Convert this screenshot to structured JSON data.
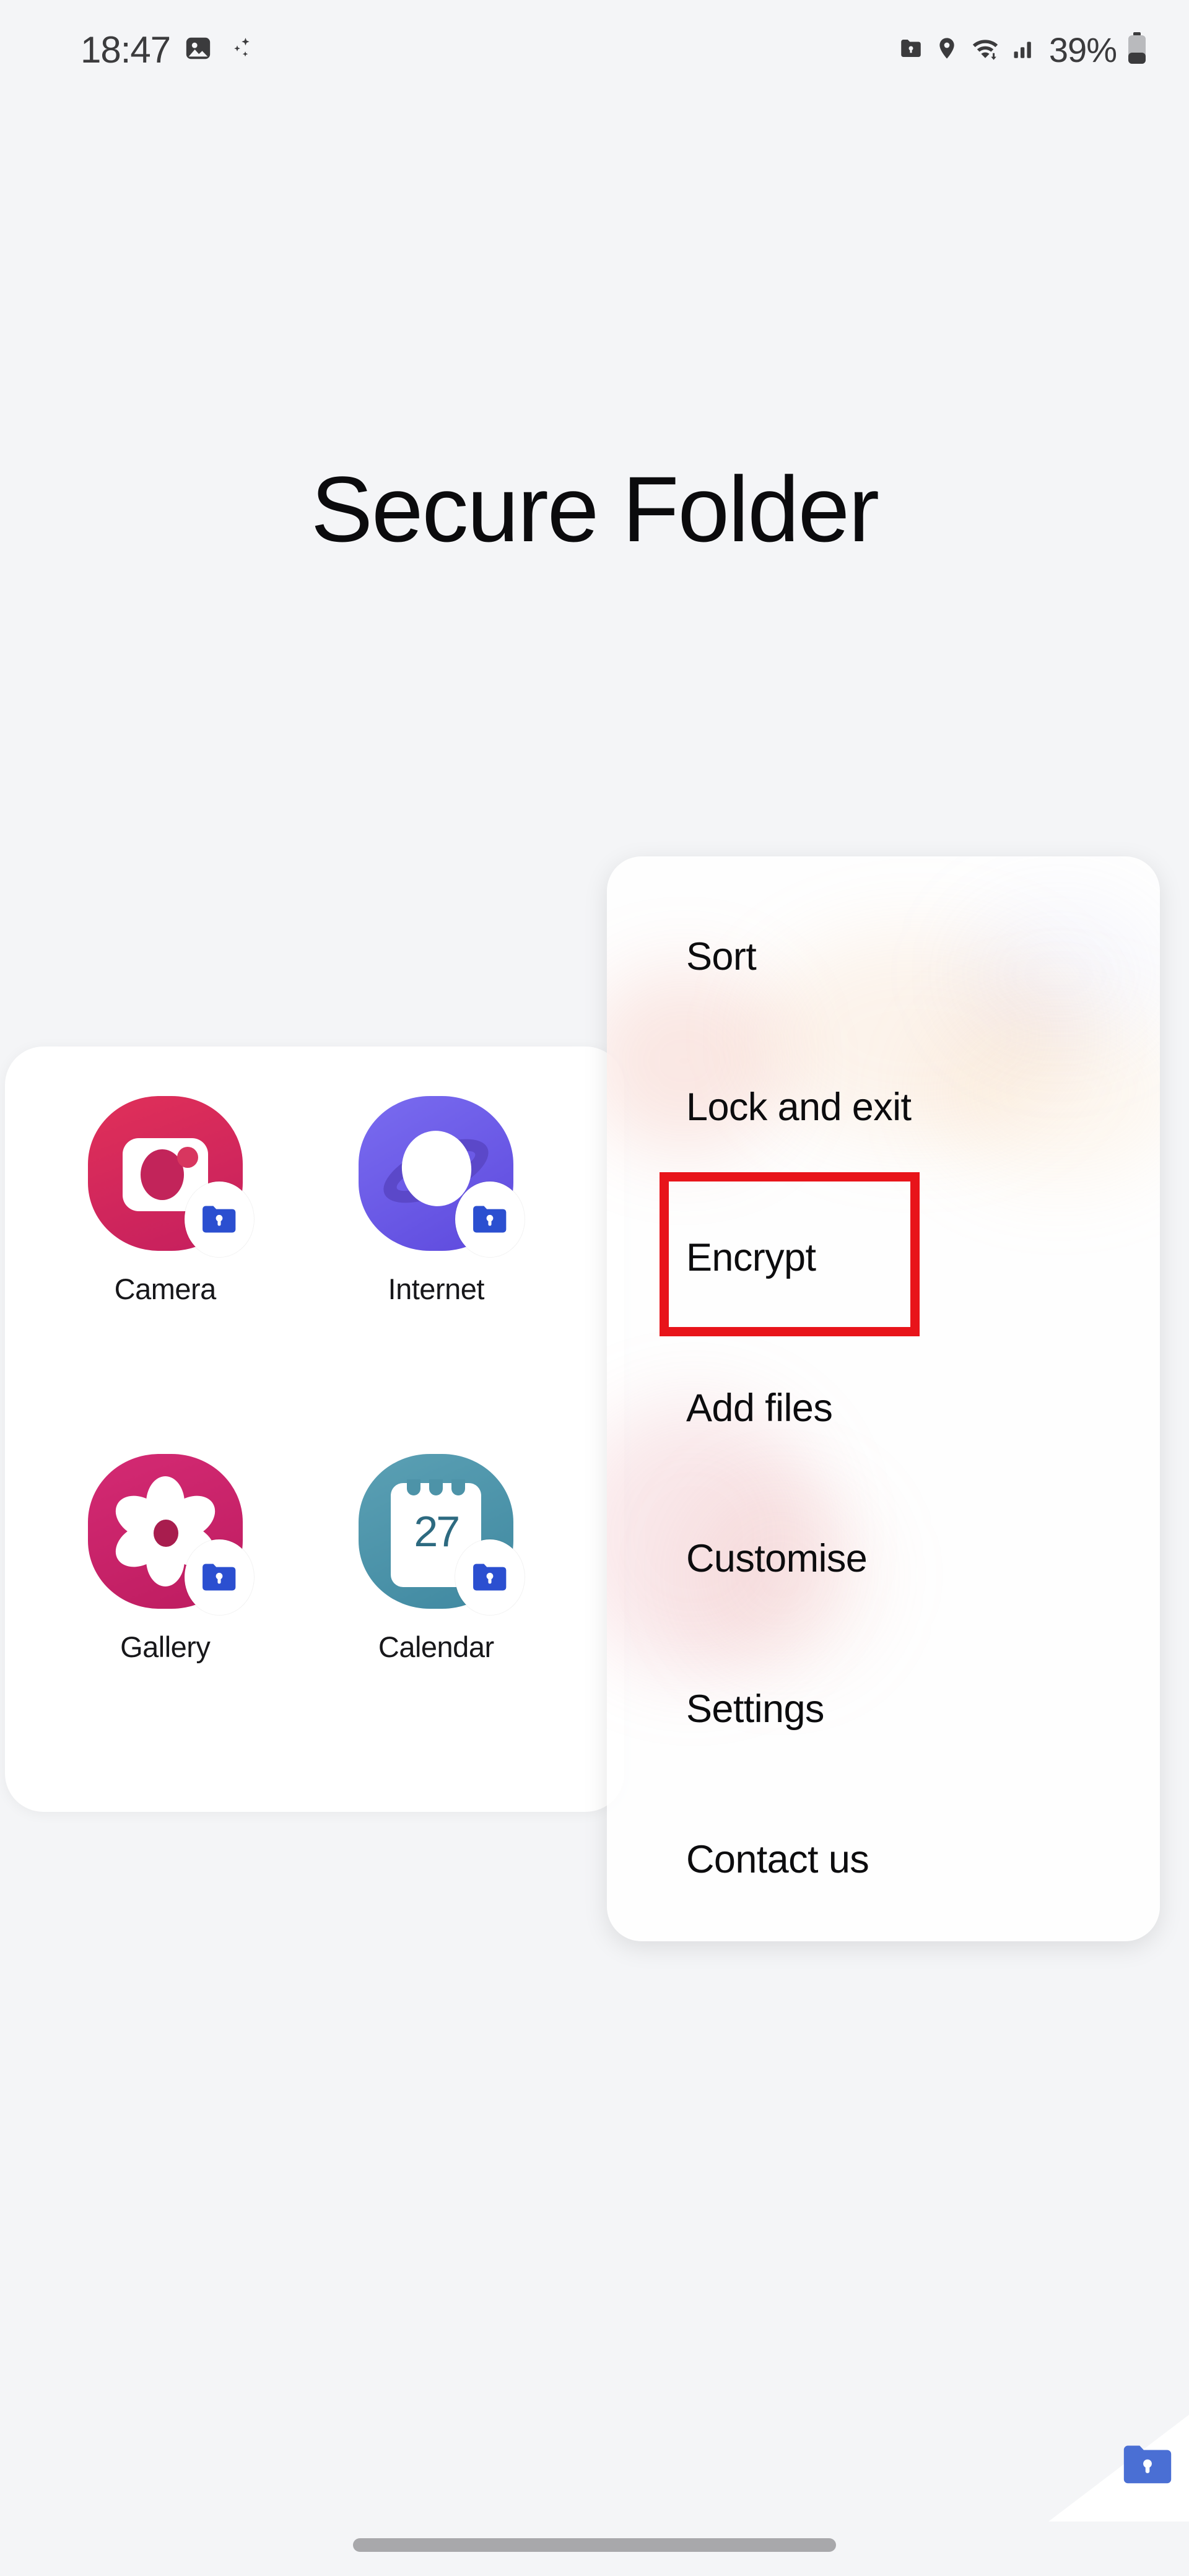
{
  "status_bar": {
    "time": "18:47",
    "battery_percent": "39%",
    "left_icons": [
      "image-icon",
      "sparkle-icon"
    ],
    "right_icons": [
      "secure-folder-icon",
      "location-pin-icon",
      "wifi-icon",
      "signal-bars-icon",
      "battery-icon"
    ]
  },
  "header": {
    "title": "Secure Folder"
  },
  "apps": [
    {
      "label": "Camera",
      "icon": "camera-icon",
      "color": "#d5295c",
      "badge": "secure-folder-lock-badge"
    },
    {
      "label": "Internet",
      "icon": "internet-icon",
      "color": "#6f5be8",
      "badge": "secure-folder-lock-badge"
    },
    {
      "label": "Gallery",
      "icon": "gallery-icon",
      "color": "#cc246c",
      "badge": "secure-folder-lock-badge"
    },
    {
      "label": "Calendar",
      "icon": "calendar-icon",
      "color": "#4d93a8",
      "badge": "secure-folder-lock-badge",
      "day": "27"
    }
  ],
  "menu": {
    "items": [
      {
        "label": "Sort"
      },
      {
        "label": "Lock and exit"
      },
      {
        "label": "Encrypt",
        "highlighted": true
      },
      {
        "label": "Add files"
      },
      {
        "label": "Customise"
      },
      {
        "label": "Settings"
      },
      {
        "label": "Contact us"
      }
    ]
  },
  "highlight": {
    "target": "Encrypt",
    "color": "#e8141a"
  },
  "corner_indicator": {
    "icon": "secure-folder-lock-icon",
    "color": "#4a6fd4"
  },
  "nav_bar": {
    "handle": "gesture-handle"
  },
  "colors": {
    "background": "#f4f5f7",
    "card": "#ffffff",
    "text": "#0c0c0e",
    "status_text": "#3b3b3d",
    "badge_blue": "#2b4fd0",
    "highlight_red": "#e8141a"
  }
}
